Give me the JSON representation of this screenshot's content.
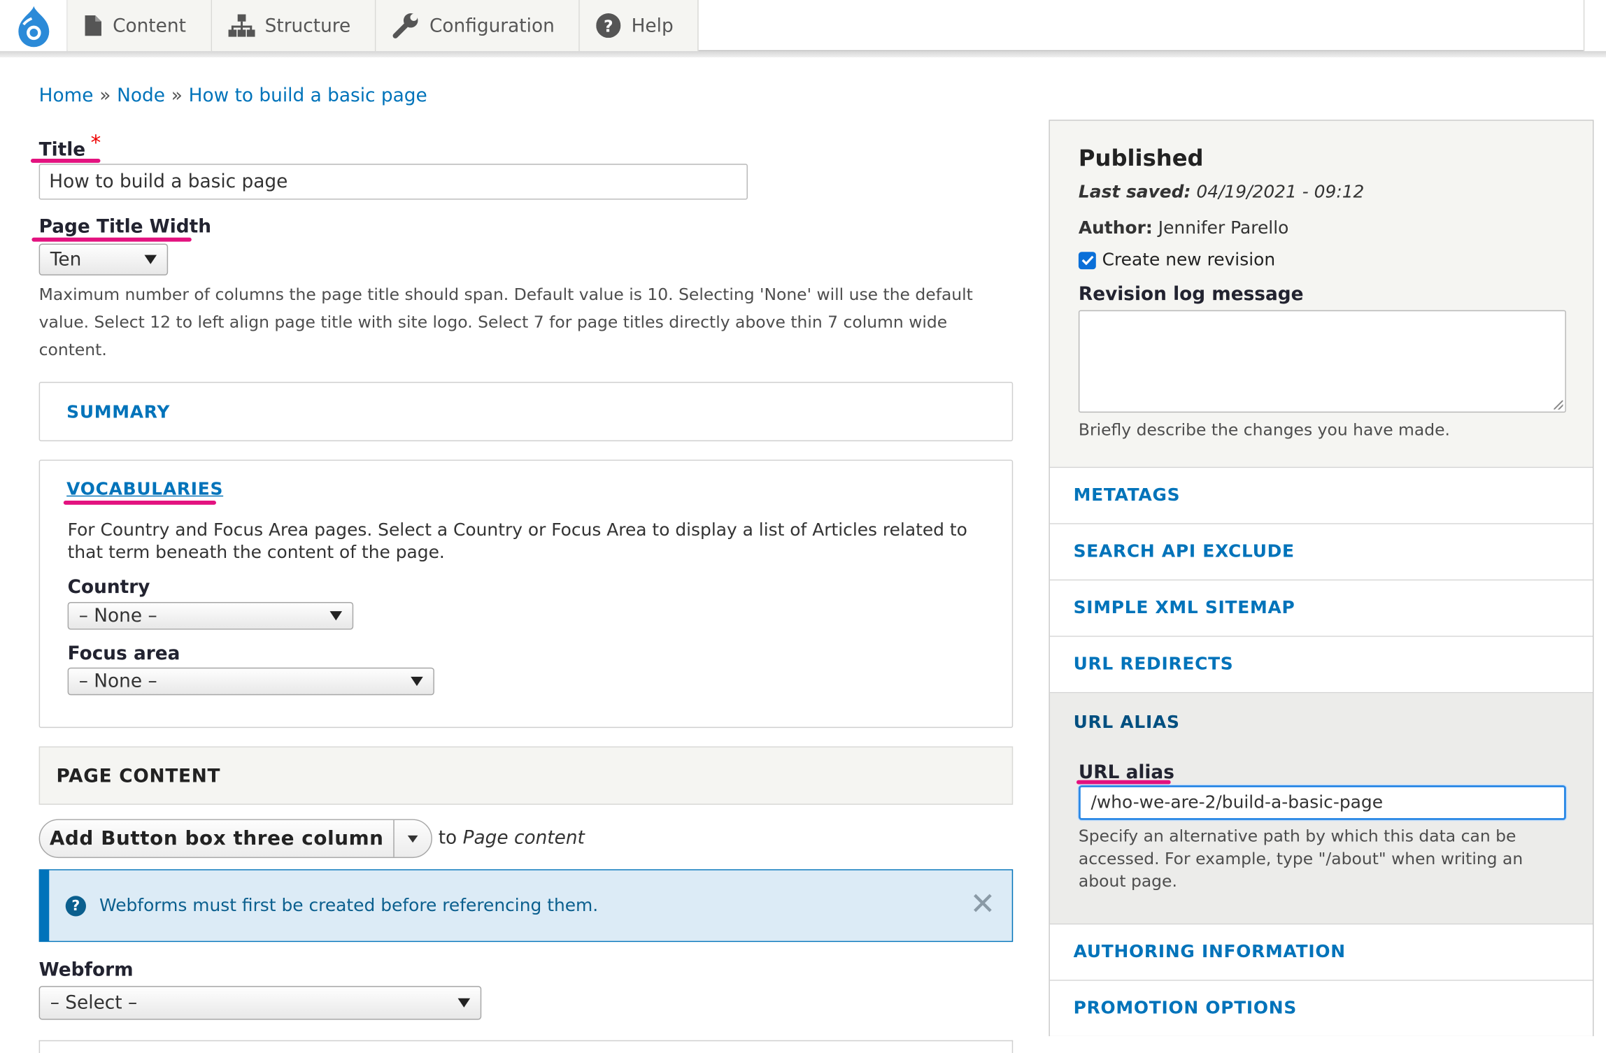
{
  "toolbar": {
    "logo_icon": "drupal-drop-icon",
    "items": [
      {
        "label": "Content",
        "icon": "document-icon"
      },
      {
        "label": "Structure",
        "icon": "sitemap-icon"
      },
      {
        "label": "Configuration",
        "icon": "wrench-icon"
      },
      {
        "label": "Help",
        "icon": "help-icon"
      }
    ]
  },
  "breadcrumb": {
    "items": [
      "Home",
      "Node",
      "How to build a basic page"
    ],
    "separator": "»"
  },
  "form": {
    "title_label": "Title",
    "required_mark": "*",
    "title_value": "How to build a basic page",
    "page_title_width_label": "Page Title Width",
    "page_title_width_value": "Ten",
    "page_title_width_desc": "Maximum number of columns the page title should span. Default value is 10. Selecting 'None' will use the default value. Select 12 to left align page title with site logo. Select 7 for page titles directly above thin 7 column wide content.",
    "summary_label": "SUMMARY",
    "vocabularies": {
      "label": "VOCABULARIES",
      "description": "For Country and Focus Area pages. Select a Country or Focus Area to display a list of Articles related to that term beneath the content of the page.",
      "country_label": "Country",
      "country_value": "– None –",
      "focus_label": "Focus area",
      "focus_value": "– None –"
    },
    "page_content": {
      "heading": "PAGE CONTENT",
      "add_button_label": "Add Button box three column",
      "to_prefix": "to",
      "to_target": "Page content"
    },
    "message": {
      "icon": "question-circle-icon",
      "text": "Webforms must first be created before referencing them."
    },
    "webform_label": "Webform",
    "webform_value": "– Select –"
  },
  "sidebar": {
    "status": "Published",
    "last_saved_label": "Last saved:",
    "last_saved_value": "04/19/2021 - 09:12",
    "author_label": "Author:",
    "author_value": "Jennifer Parello",
    "create_revision_label": "Create new revision",
    "create_revision_checked": true,
    "revision_log_label": "Revision log message",
    "revision_log_desc": "Briefly describe the changes you have made.",
    "sections_top": [
      "METATAGS",
      "SEARCH API EXCLUDE",
      "SIMPLE XML SITEMAP",
      "URL REDIRECTS"
    ],
    "url_alias": {
      "title": "URL ALIAS",
      "field_label": "URL alias",
      "value": "/who-we-are-2/build-a-basic-page",
      "description": "Specify an alternative path by which this data can be accessed. For example, type \"/about\" when writing an about page."
    },
    "sections_bottom": [
      "AUTHORING INFORMATION",
      "PROMOTION OPTIONS"
    ]
  },
  "colors": {
    "link": "#0073ba",
    "annotation_underline": "#e3127f",
    "message_bg": "#dcebf6",
    "required": "#e00000"
  }
}
